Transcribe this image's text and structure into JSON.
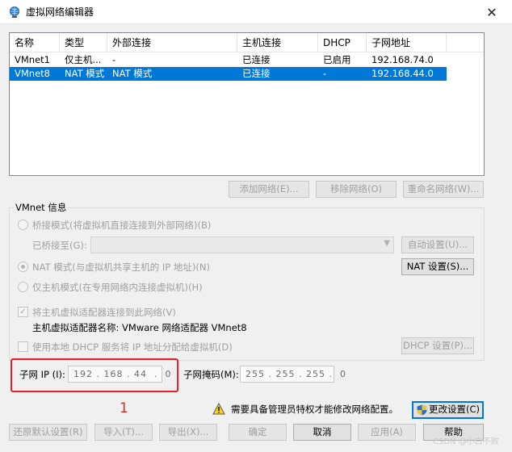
{
  "window": {
    "title": "虚拟网络编辑器",
    "close_glyph": "✕"
  },
  "table": {
    "headers": [
      "名称",
      "类型",
      "外部连接",
      "主机连接",
      "DHCP",
      "子网地址"
    ],
    "rows": [
      {
        "name": "VMnet1",
        "type": "仅主机...",
        "external": "-",
        "host": "已连接",
        "dhcp": "已启用",
        "subnet": "192.168.74.0",
        "selected": false
      },
      {
        "name": "VMnet8",
        "type": "NAT 模式",
        "external": "NAT 模式",
        "host": "已连接",
        "dhcp": "-",
        "subnet": "192.168.44.0",
        "selected": true
      }
    ]
  },
  "table_buttons": {
    "add": "添加网络(E)...",
    "remove": "移除网络(O)",
    "rename": "重命名网络(W)..."
  },
  "vmnet_info": {
    "group_title": "VMnet 信息",
    "bridge_radio": "桥接模式(将虚拟机直接连接到外部网络)(B)",
    "bridged_to_label": "已桥接至(G):",
    "auto_settings": "自动设置(U)...",
    "nat_radio": "NAT 模式(与虚拟机共享主机的 IP 地址)(N)",
    "nat_settings": "NAT 设置(S)...",
    "hostonly_radio": "仅主机模式(在专用网络内连接虚拟机)(H)",
    "connect_adapter_check": "将主机虚拟适配器连接到此网络(V)",
    "connect_adapter_checked": true,
    "adapter_name_label": "主机虚拟适配器名称: VMware 网络适配器 VMnet8",
    "dhcp_check": "使用本地 DHCP 服务将 IP 地址分配给虚拟机(D)",
    "dhcp_checked": false,
    "dhcp_settings": "DHCP 设置(P)...",
    "subnet_ip_label": "子网 IP (I):",
    "subnet_ip_value": "192 . 168 . 44  .  0",
    "subnet_mask_label": "子网掩码(M):",
    "subnet_mask_value": "255 . 255 . 255 .  0"
  },
  "admin_notice": {
    "text": "需要具备管理员特权才能修改网络配置。",
    "change_settings": "更改设置(C)"
  },
  "bottom_buttons": {
    "restore": "还原默认设置(R)",
    "import": "导入(T)...",
    "export": "导出(X)...",
    "ok": "确定",
    "cancel": "取消",
    "apply": "应用(A)",
    "help": "帮助"
  },
  "annotation": {
    "number": "1",
    "color": "#e8202a"
  },
  "watermark": "CSDN @小白不败",
  "colors": {
    "selection": "#0078d7",
    "highlight_box": "#e8202a",
    "shield_blue": "#2b6cd4",
    "shield_yellow": "#f2c330"
  }
}
